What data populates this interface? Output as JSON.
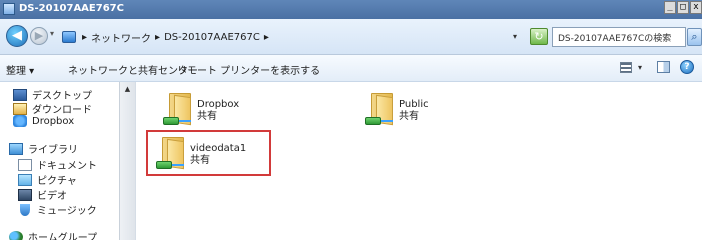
{
  "window": {
    "title": "DS-20107AAE767C",
    "caption_buttons": {
      "minimize": "_",
      "maximize": "□",
      "close": "x"
    }
  },
  "address_bar": {
    "segments": [
      "ネットワーク",
      "▸",
      "DS-20107AAE767C",
      "▸"
    ],
    "search_placeholder": "DS-20107AAE767Cの検索"
  },
  "command_bar": {
    "organize": "整理 ▾",
    "network_center": "ネットワークと共有センター",
    "remote_printers": "リモート プリンターを表示する"
  },
  "nav": {
    "items": [
      {
        "label": "デスクトップ",
        "icon": "desktop-icon"
      },
      {
        "label": "ダウンロード",
        "icon": "download-icon"
      },
      {
        "label": "Dropbox",
        "icon": "dropbox-icon"
      },
      {
        "label": "ライブラリ",
        "icon": "library-icon"
      },
      {
        "label": "ドキュメント",
        "icon": "document-icon"
      },
      {
        "label": "ピクチャ",
        "icon": "picture-icon"
      },
      {
        "label": "ビデオ",
        "icon": "video-icon"
      },
      {
        "label": "ミュージック",
        "icon": "music-icon"
      },
      {
        "label": "ホームグループ",
        "icon": "homegroup-icon"
      }
    ]
  },
  "content": {
    "folders": [
      {
        "name": "Dropbox",
        "status": "共有"
      },
      {
        "name": "Public",
        "status": "共有"
      },
      {
        "name": "videodata1",
        "status": "共有"
      }
    ]
  },
  "colors": {
    "titlebar": "#4a70a3",
    "highlight_border": "#d23a3a",
    "folder": "#eec561"
  }
}
